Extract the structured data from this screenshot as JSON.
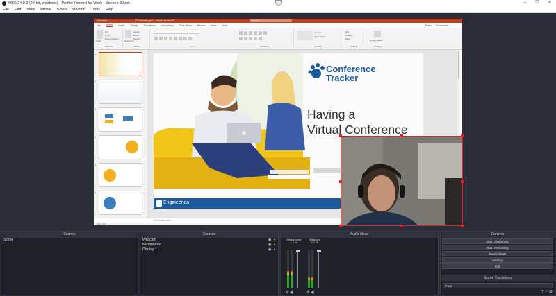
{
  "window": {
    "title": "OBS 24.0.3 (64-bit, windows) - Profile: Record for Work - Scenes: Blank",
    "minimize": "–",
    "maximize": "☐",
    "close": "✕"
  },
  "menu": [
    "File",
    "Edit",
    "View",
    "Profile",
    "Scene Collection",
    "Tools",
    "Help"
  ],
  "powerpoint": {
    "autosave": "AutoSave",
    "doc_title": "CT-Webinar.pptx",
    "saved_status": "Saved to this PC",
    "search_placeholder": "Search",
    "user": "",
    "tabs": [
      "File",
      "Home",
      "Insert",
      "Design",
      "Transitions",
      "Animations",
      "Slide Show",
      "Review",
      "View",
      "Help"
    ],
    "active_tab": "Home",
    "share": "Share",
    "comments": "Comments",
    "ribbon_groups": [
      "Clipboard",
      "Slides",
      "Font",
      "Paragraph",
      "Drawing",
      "Editing",
      "Designer"
    ],
    "ribbon_items": {
      "paste": "Paste",
      "cut": "Cut",
      "copy": "Copy",
      "format_painter": "Format Painter",
      "new_slide": "New Slide",
      "layout": "Layout",
      "reset": "Reset",
      "section": "Section",
      "arrange": "Arrange",
      "quick_styles": "Quick Styles",
      "find": "Find",
      "replace": "Replace",
      "select": "Select",
      "design_ideas": "Design Ideas"
    },
    "slide_numbers": [
      "1",
      "2",
      "3",
      "4",
      "5",
      "6"
    ],
    "slide": {
      "brand_line1": "Conference",
      "brand_line2": "Tracker",
      "title_line1": "Having a",
      "title_line2": "Virtual Conference",
      "footer_label": "Engineerica"
    },
    "notes_placeholder": "Click to add notes",
    "slide_counter": "Slide 1 of 11"
  },
  "docks": {
    "scenes": {
      "header": "Scenes",
      "items": [
        "Scene"
      ]
    },
    "sources": {
      "header": "Sources",
      "items": [
        "Webcam",
        "Microphone",
        "Display 1"
      ]
    },
    "audio_mixer": {
      "header": "Audio Mixer",
      "channels": [
        {
          "name": "Microphone",
          "db": "0.0 dB",
          "level": 0.45
        },
        {
          "name": "Webcam",
          "db": "0.0 dB",
          "level": 0.3
        }
      ]
    },
    "controls": {
      "header": "Controls",
      "buttons": [
        "Start Streaming",
        "Start Recording",
        "Studio Mode",
        "Settings",
        "Exit"
      ]
    },
    "scene_transitions": {
      "header": "Scene Transitions",
      "selected": "Fade"
    }
  }
}
